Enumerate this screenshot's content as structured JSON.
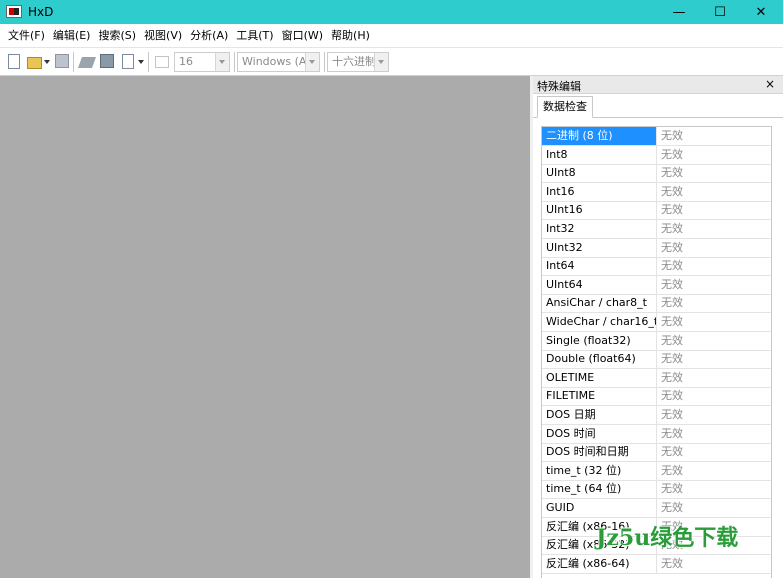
{
  "window": {
    "title": "HxD"
  },
  "window_controls": {
    "minimize": "—",
    "maximize": "☐",
    "close": "✕"
  },
  "menu": [
    "文件(F)",
    "编辑(E)",
    "搜索(S)",
    "视图(V)",
    "分析(A)",
    "工具(T)",
    "窗口(W)",
    "帮助(H)"
  ],
  "toolbar": {
    "bytes_per_row": "16",
    "charset": "Windows (AN",
    "offset_base": "十六进制"
  },
  "panel": {
    "title": "特殊编辑",
    "close": "×",
    "tab": "数据检查",
    "rows": [
      {
        "key": "二进制 (8 位)",
        "value": "无效"
      },
      {
        "key": "Int8",
        "value": "无效"
      },
      {
        "key": "UInt8",
        "value": "无效"
      },
      {
        "key": "Int16",
        "value": "无效"
      },
      {
        "key": "UInt16",
        "value": "无效"
      },
      {
        "key": "Int32",
        "value": "无效"
      },
      {
        "key": "UInt32",
        "value": "无效"
      },
      {
        "key": "Int64",
        "value": "无效"
      },
      {
        "key": "UInt64",
        "value": "无效"
      },
      {
        "key": "AnsiChar / char8_t",
        "value": "无效"
      },
      {
        "key": "WideChar / char16_t",
        "value": "无效"
      },
      {
        "key": "Single (float32)",
        "value": "无效"
      },
      {
        "key": "Double (float64)",
        "value": "无效"
      },
      {
        "key": "OLETIME",
        "value": "无效"
      },
      {
        "key": "FILETIME",
        "value": "无效"
      },
      {
        "key": "DOS 日期",
        "value": "无效"
      },
      {
        "key": "DOS 时间",
        "value": "无效"
      },
      {
        "key": "DOS 时间和日期",
        "value": "无效"
      },
      {
        "key": "time_t (32 位)",
        "value": "无效"
      },
      {
        "key": "time_t (64 位)",
        "value": "无效"
      },
      {
        "key": "GUID",
        "value": "无效"
      },
      {
        "key": "反汇编 (x86-16)",
        "value": "无效"
      },
      {
        "key": "反汇编 (x86-32)",
        "value": "无效"
      },
      {
        "key": "反汇编 (x86-64)",
        "value": "无效"
      }
    ]
  },
  "watermark": "Jz5u绿色下载"
}
